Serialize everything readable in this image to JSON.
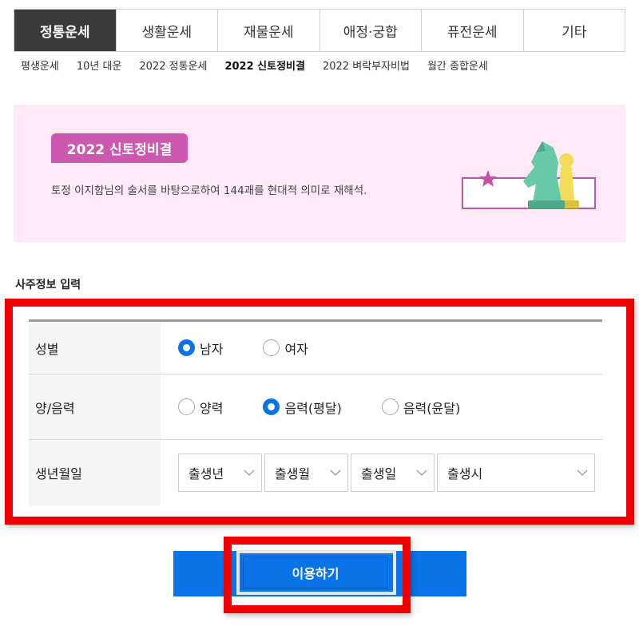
{
  "tabs": [
    {
      "label": "정통운세",
      "active": true
    },
    {
      "label": "생활운세",
      "active": false
    },
    {
      "label": "재물운세",
      "active": false
    },
    {
      "label": "애정·궁합",
      "active": false
    },
    {
      "label": "퓨전운세",
      "active": false
    },
    {
      "label": "기타",
      "active": false
    }
  ],
  "submenu": [
    {
      "label": "평생운세",
      "active": false
    },
    {
      "label": "10년 대운",
      "active": false
    },
    {
      "label": "2022 정통운세",
      "active": false
    },
    {
      "label": "2022 신토정비결",
      "active": true
    },
    {
      "label": "2022 벼락부자비법",
      "active": false
    },
    {
      "label": "월간 종합운세",
      "active": false
    }
  ],
  "banner": {
    "badge": "2022 신토정비결",
    "description": "토정 이지함님의 술서를 바탕으로하여 144괘를 현대적 의미로 재해석."
  },
  "form": {
    "section_title": "사주정보 입력",
    "gender": {
      "label": "성별",
      "options": [
        {
          "label": "남자",
          "checked": true
        },
        {
          "label": "여자",
          "checked": false
        }
      ]
    },
    "calendar": {
      "label": "양/음력",
      "options": [
        {
          "label": "양력",
          "checked": false
        },
        {
          "label": "음력(평달)",
          "checked": true
        },
        {
          "label": "음력(윤달)",
          "checked": false
        }
      ]
    },
    "birth": {
      "label": "생년월일",
      "year": "출생년",
      "month": "출생월",
      "day": "출생일",
      "time": "출생시"
    }
  },
  "submit_label": "이용하기",
  "colors": {
    "accent": "#0a73e8",
    "highlight": "#ee0000",
    "banner_bg": "#fdeaf6",
    "badge": "#cc58b0",
    "tab_active": "#3a3a3a"
  }
}
